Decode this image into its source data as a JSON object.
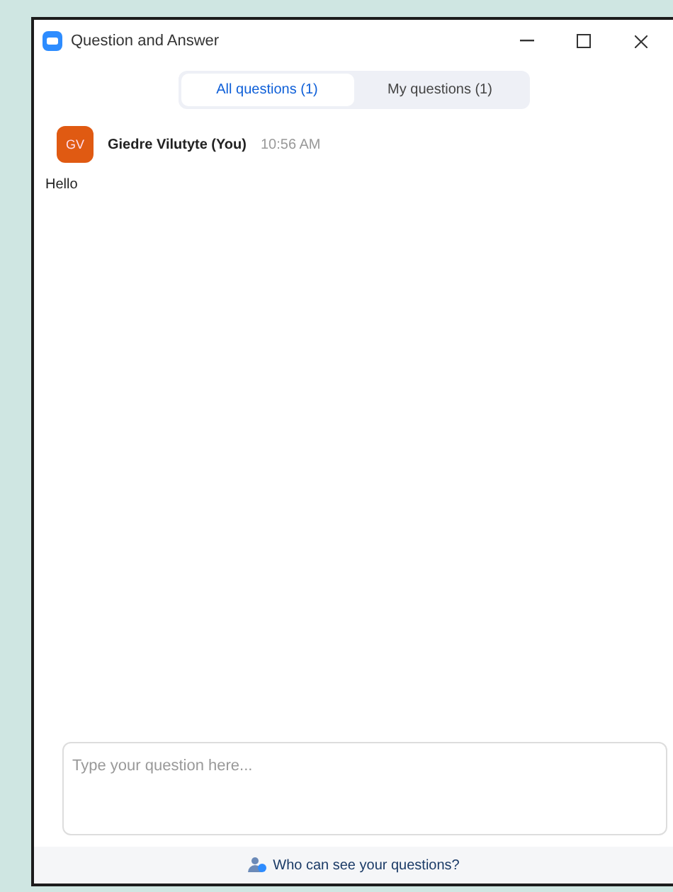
{
  "window": {
    "title": "Question and Answer"
  },
  "tabs": [
    {
      "label": "All questions (1)",
      "selected": true
    },
    {
      "label": "My questions (1)",
      "selected": false
    }
  ],
  "messages": [
    {
      "initials": "GV",
      "author": "Giedre Vilutyte (You)",
      "time": "10:56 AM",
      "text": "Hello"
    }
  ],
  "question_field": {
    "placeholder": "Type your question here..."
  },
  "footer_link": "Who can see your questions?"
}
